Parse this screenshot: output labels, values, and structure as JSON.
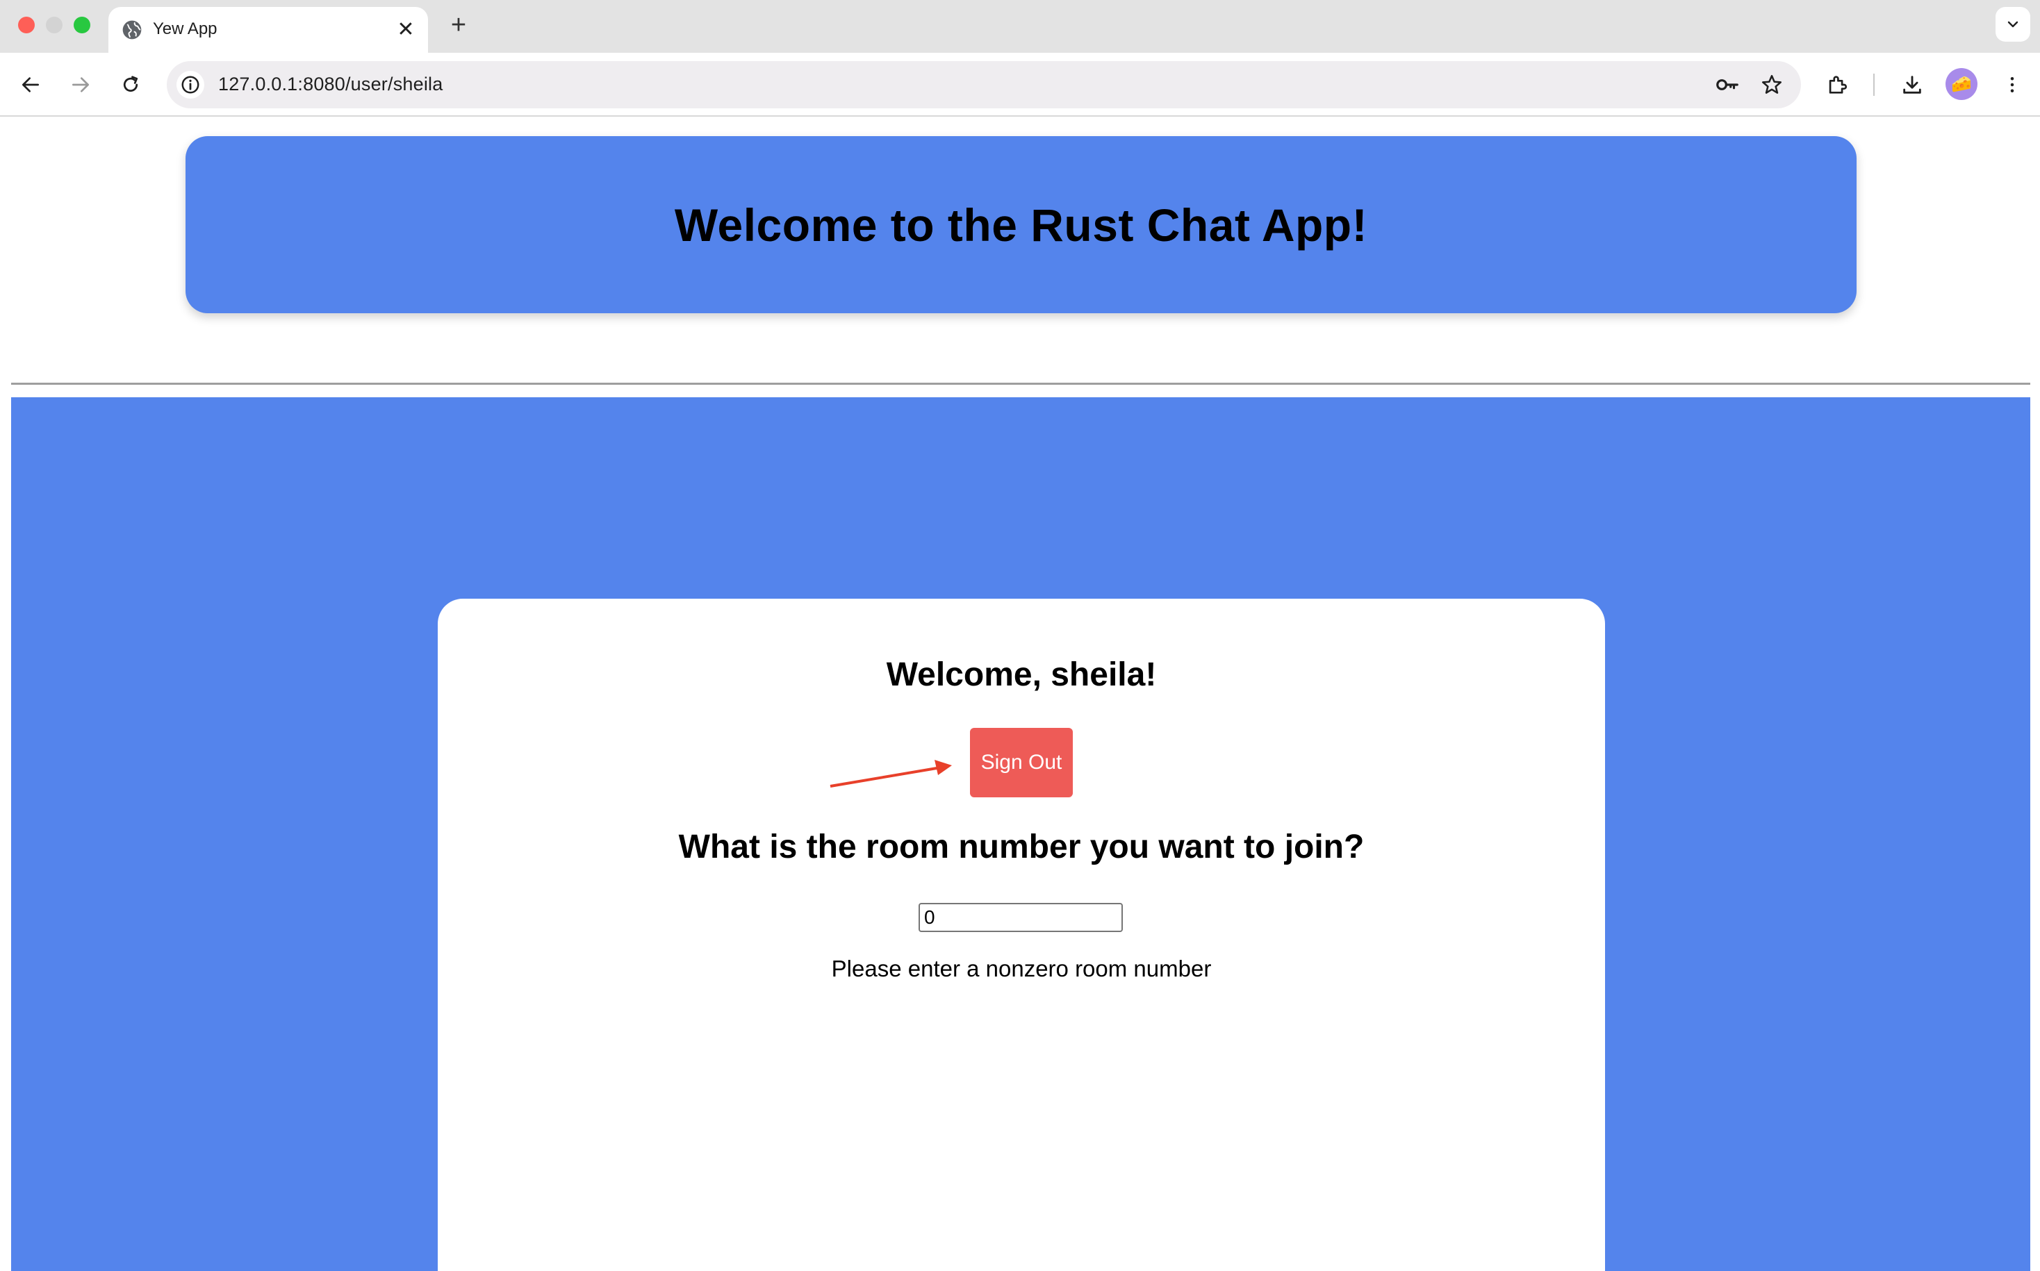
{
  "browser": {
    "tab": {
      "title": "Yew App",
      "favicon": "globe-icon"
    },
    "new_tab_symbol": "+",
    "close_symbol": "✕",
    "address_bar": {
      "url": "127.0.0.1:8080/user/sheila"
    },
    "icons": [
      "back-arrow-icon",
      "forward-arrow-icon",
      "reload-icon",
      "site-info-icon",
      "password-key-icon",
      "bookmark-star-icon",
      "extensions-icon",
      "download-icon",
      "profile-avatar-icon",
      "more-menu-icon",
      "tab-search-chevron-icon"
    ],
    "avatar_emoji": "🧀"
  },
  "page": {
    "header_title": "Welcome to the Rust Chat App!",
    "welcome_text": "Welcome, sheila!",
    "sign_out_label": "Sign Out",
    "room_question": "What is the room number you want to join?",
    "room_input_value": "0",
    "hint_text": "Please enter a nonzero room number"
  },
  "colors": {
    "primary_blue": "#5484ec",
    "sign_out_red": "#ee5b57",
    "annotation_arrow": "#e8402a"
  }
}
